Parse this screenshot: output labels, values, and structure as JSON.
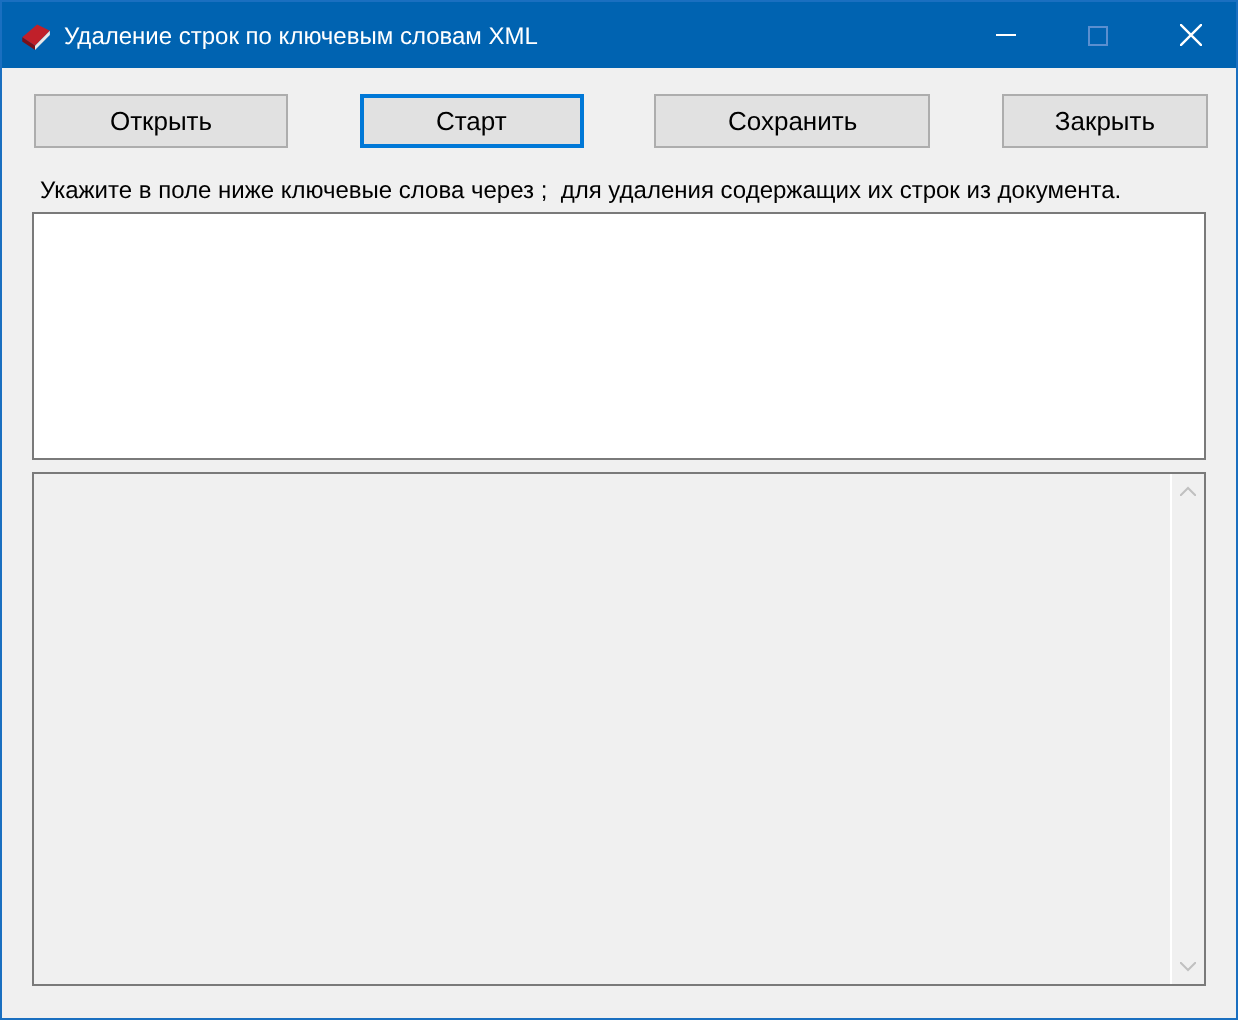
{
  "window": {
    "title": "Удаление строк по ключевым словам XML"
  },
  "buttons": [
    {
      "label": "Открыть",
      "focused": false
    },
    {
      "label": "Старт",
      "focused": true
    },
    {
      "label": "Сохранить",
      "focused": false
    },
    {
      "label": "Закрыть",
      "focused": false
    }
  ],
  "instruction": "Укажите в поле ниже ключевые слова через ;  для удаления содержащих их строк из документа."
}
